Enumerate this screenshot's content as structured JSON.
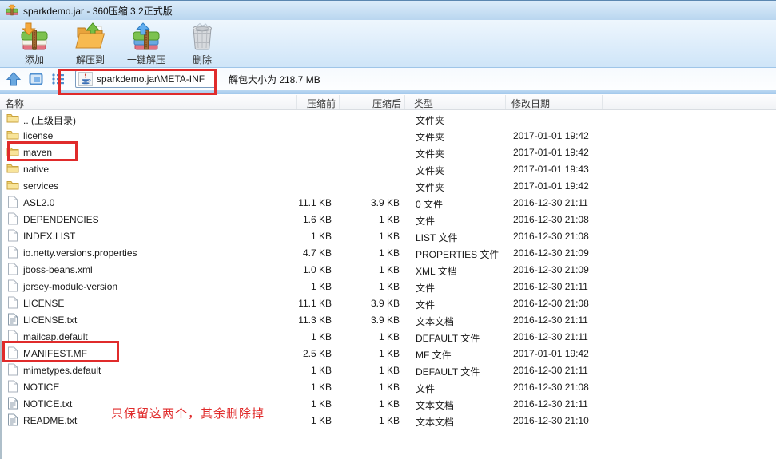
{
  "window": {
    "title": "sparkdemo.jar - 360压缩 3.2正式版",
    "icon": "360zip-app-icon"
  },
  "toolbar": {
    "buttons": [
      {
        "id": "add",
        "label": "添加",
        "icon": "add-to-archive-icon"
      },
      {
        "id": "extract-to",
        "label": "解压到",
        "icon": "extract-to-icon"
      },
      {
        "id": "one-click-extract",
        "label": "一键解压",
        "icon": "one-click-extract-icon"
      },
      {
        "id": "delete",
        "label": "删除",
        "icon": "delete-icon"
      }
    ]
  },
  "navbar": {
    "nav_icons": [
      "up-icon",
      "view-mode-icon",
      "list-view-icon"
    ],
    "path": "sparkdemo.jar\\META-INF",
    "path_icon": "java-file-icon",
    "unpacked_size_text": "解包大小为 218.7 MB"
  },
  "table": {
    "headers": {
      "name": "名称",
      "size_before": "压缩前",
      "size_after": "压缩后",
      "type": "类型",
      "date": "修改日期"
    },
    "rows": [
      {
        "name": ".. (上级目录)",
        "icon": "folder",
        "size_before": "",
        "size_after": "",
        "type": "文件夹",
        "date": "",
        "highlighted": false
      },
      {
        "name": "license",
        "icon": "folder",
        "size_before": "",
        "size_after": "",
        "type": "文件夹",
        "date": "2017-01-01 19:42",
        "highlighted": false
      },
      {
        "name": "maven",
        "icon": "folder",
        "size_before": "",
        "size_after": "",
        "type": "文件夹",
        "date": "2017-01-01 19:42",
        "highlighted": true
      },
      {
        "name": "native",
        "icon": "folder",
        "size_before": "",
        "size_after": "",
        "type": "文件夹",
        "date": "2017-01-01 19:43",
        "highlighted": false
      },
      {
        "name": "services",
        "icon": "folder",
        "size_before": "",
        "size_after": "",
        "type": "文件夹",
        "date": "2017-01-01 19:42",
        "highlighted": false
      },
      {
        "name": "ASL2.0",
        "icon": "file",
        "size_before": "11.1 KB",
        "size_after": "3.9 KB",
        "type": "0 文件",
        "date": "2016-12-30 21:11",
        "highlighted": false
      },
      {
        "name": "DEPENDENCIES",
        "icon": "file",
        "size_before": "1.6 KB",
        "size_after": "1 KB",
        "type": "文件",
        "date": "2016-12-30 21:08",
        "highlighted": false
      },
      {
        "name": "INDEX.LIST",
        "icon": "file",
        "size_before": "1 KB",
        "size_after": "1 KB",
        "type": "LIST 文件",
        "date": "2016-12-30 21:08",
        "highlighted": false
      },
      {
        "name": "io.netty.versions.properties",
        "icon": "file",
        "size_before": "4.7 KB",
        "size_after": "1 KB",
        "type": "PROPERTIES 文件",
        "date": "2016-12-30 21:09",
        "highlighted": false
      },
      {
        "name": "jboss-beans.xml",
        "icon": "file",
        "size_before": "1.0 KB",
        "size_after": "1 KB",
        "type": "XML 文档",
        "date": "2016-12-30 21:09",
        "highlighted": false
      },
      {
        "name": "jersey-module-version",
        "icon": "file",
        "size_before": "1 KB",
        "size_after": "1 KB",
        "type": "文件",
        "date": "2016-12-30 21:11",
        "highlighted": false
      },
      {
        "name": "LICENSE",
        "icon": "file",
        "size_before": "11.1 KB",
        "size_after": "3.9 KB",
        "type": "文件",
        "date": "2016-12-30 21:08",
        "highlighted": false
      },
      {
        "name": "LICENSE.txt",
        "icon": "text-file",
        "size_before": "11.3 KB",
        "size_after": "3.9 KB",
        "type": "文本文档",
        "date": "2016-12-30 21:11",
        "highlighted": false
      },
      {
        "name": "mailcap.default",
        "icon": "file",
        "size_before": "1 KB",
        "size_after": "1 KB",
        "type": "DEFAULT 文件",
        "date": "2016-12-30 21:11",
        "highlighted": false
      },
      {
        "name": "MANIFEST.MF",
        "icon": "file",
        "size_before": "2.5 KB",
        "size_after": "1 KB",
        "type": "MF 文件",
        "date": "2017-01-01 19:42",
        "highlighted": true
      },
      {
        "name": "mimetypes.default",
        "icon": "file",
        "size_before": "1 KB",
        "size_after": "1 KB",
        "type": "DEFAULT 文件",
        "date": "2016-12-30 21:11",
        "highlighted": false
      },
      {
        "name": "NOTICE",
        "icon": "file",
        "size_before": "1 KB",
        "size_after": "1 KB",
        "type": "文件",
        "date": "2016-12-30 21:08",
        "highlighted": false
      },
      {
        "name": "NOTICE.txt",
        "icon": "text-file",
        "size_before": "1 KB",
        "size_after": "1 KB",
        "type": "文本文档",
        "date": "2016-12-30 21:11",
        "highlighted": false
      },
      {
        "name": "README.txt",
        "icon": "text-file",
        "size_before": "1 KB",
        "size_after": "1 KB",
        "type": "文本文档",
        "date": "2016-12-30 21:10",
        "highlighted": false
      }
    ]
  },
  "annotations": {
    "note_text": "只保留这两个，其余删除掉",
    "highlight_color": "#e02b2b"
  },
  "colors": {
    "titlebar_top": "#dcecfa",
    "titlebar_bottom": "#b9d6ef",
    "toolbar_bottom": "#cfe5f8",
    "folder_yellow": "#f3d573",
    "annotation_red": "#e02b2b"
  }
}
